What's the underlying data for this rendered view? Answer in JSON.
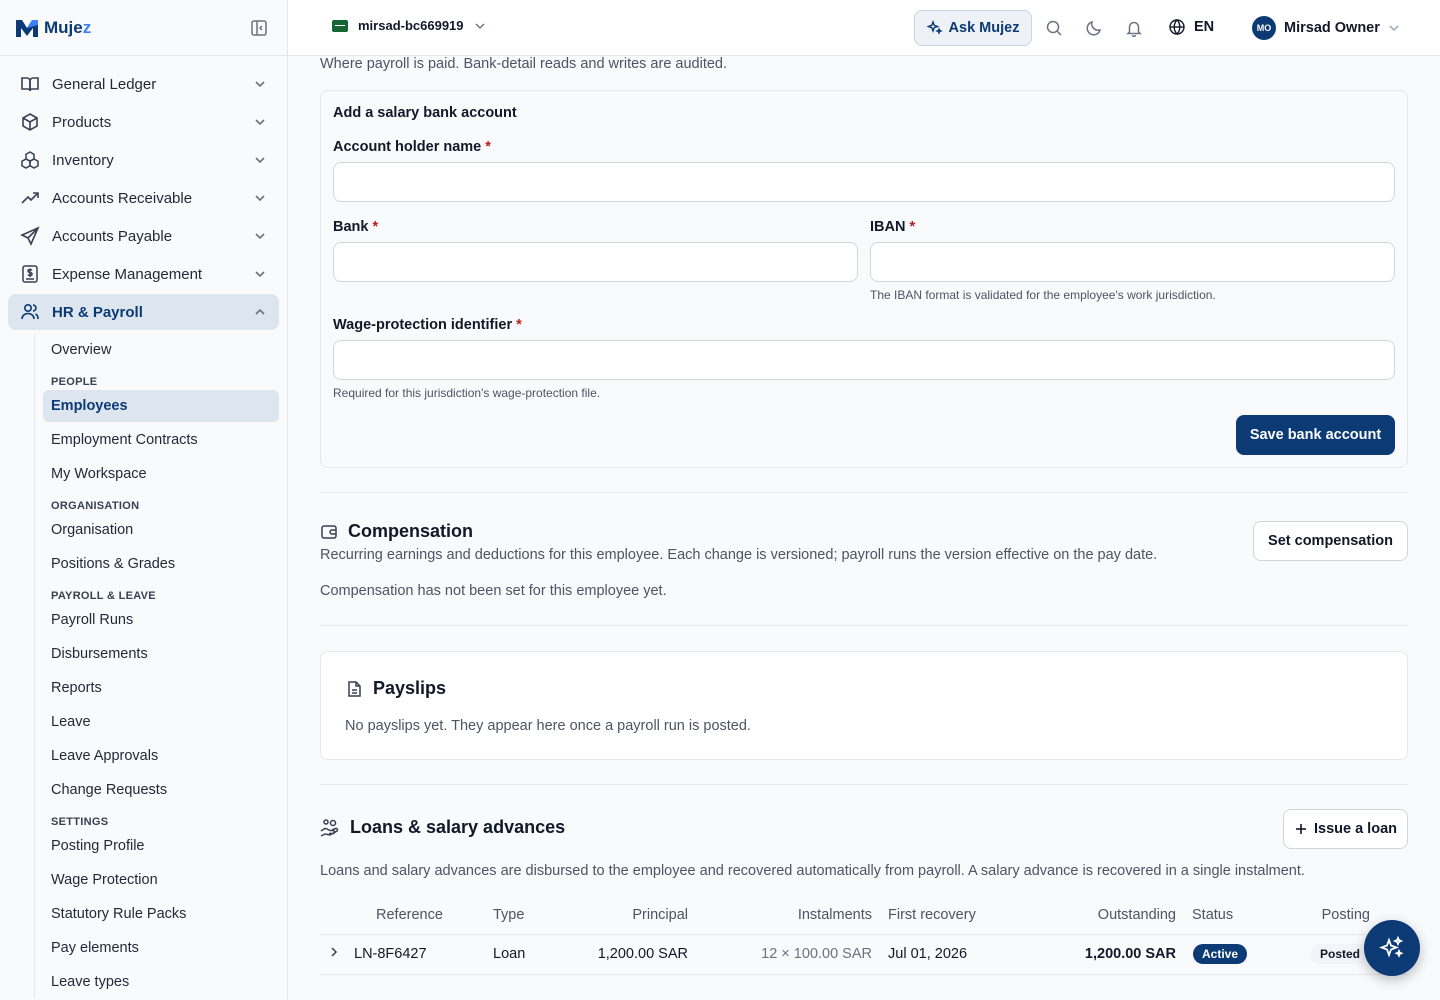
{
  "brand": {
    "name_main": "Muje",
    "name_accent": "z"
  },
  "sidebar": {
    "items": [
      {
        "label": "General Ledger",
        "icon": "book-icon"
      },
      {
        "label": "Products",
        "icon": "box-icon"
      },
      {
        "label": "Inventory",
        "icon": "boxes-icon"
      },
      {
        "label": "Accounts Receivable",
        "icon": "trending-up-icon"
      },
      {
        "label": "Accounts Payable",
        "icon": "send-icon"
      },
      {
        "label": "Expense Management",
        "icon": "receipt-dollar-icon"
      },
      {
        "label": "HR & Payroll",
        "icon": "users-icon"
      }
    ],
    "hr_sub": {
      "overview": "Overview",
      "group_people": "PEOPLE",
      "employees": "Employees",
      "employment_contracts": "Employment Contracts",
      "my_workspace": "My Workspace",
      "group_organisation": "ORGANISATION",
      "organisation": "Organisation",
      "positions_grades": "Positions & Grades",
      "group_payroll_leave": "PAYROLL & LEAVE",
      "payroll_runs": "Payroll Runs",
      "disbursements": "Disbursements",
      "reports": "Reports",
      "leave": "Leave",
      "leave_approvals": "Leave Approvals",
      "change_requests": "Change Requests",
      "group_settings": "SETTINGS",
      "posting_profile": "Posting Profile",
      "wage_protection": "Wage Protection",
      "statutory_rule_packs": "Statutory Rule Packs",
      "pay_elements": "Pay elements",
      "leave_types": "Leave types"
    }
  },
  "topbar": {
    "tenant": "mirsad-bc669919",
    "ask_label": "Ask Mujez",
    "language": "EN",
    "user_initials": "MO",
    "user_name": "Mirsad Owner"
  },
  "bank": {
    "intro": "Where payroll is paid. Bank-detail reads and writes are audited.",
    "form_title": "Add a salary bank account",
    "holder_label": "Account holder name",
    "bank_label": "Bank",
    "iban_label": "IBAN",
    "iban_hint": "The IBAN format is validated for the employee's work jurisdiction.",
    "wps_label": "Wage-protection identifier",
    "wps_hint": "Required for this jurisdiction's wage-protection file.",
    "required_mark": "*",
    "save_label": "Save bank account"
  },
  "compensation": {
    "title": "Compensation",
    "description": "Recurring earnings and deductions for this employee. Each change is versioned; payroll runs the version effective on the pay date.",
    "empty": "Compensation has not been set for this employee yet.",
    "button": "Set compensation"
  },
  "payslips": {
    "title": "Payslips",
    "empty": "No payslips yet. They appear here once a payroll run is posted."
  },
  "loans": {
    "title": "Loans & salary advances",
    "description": "Loans and salary advances are disbursed to the employee and recovered automatically from payroll. A salary advance is recovered in a single instalment.",
    "button": "Issue a loan",
    "columns": {
      "reference": "Reference",
      "type": "Type",
      "principal": "Principal",
      "instalments": "Instalments",
      "first_recovery": "First recovery",
      "outstanding": "Outstanding",
      "status": "Status",
      "posting": "Posting"
    },
    "rows": [
      {
        "reference": "LN-8F6427",
        "type": "Loan",
        "principal": "1,200.00 SAR",
        "instalments": "12 × 100.00 SAR",
        "first_recovery": "Jul 01, 2026",
        "outstanding": "1,200.00 SAR",
        "status": "Active",
        "posting": "Posted"
      }
    ]
  },
  "colors": {
    "primary": "#0b3a75",
    "accent": "#3b82f6",
    "required": "#b91c1c"
  }
}
